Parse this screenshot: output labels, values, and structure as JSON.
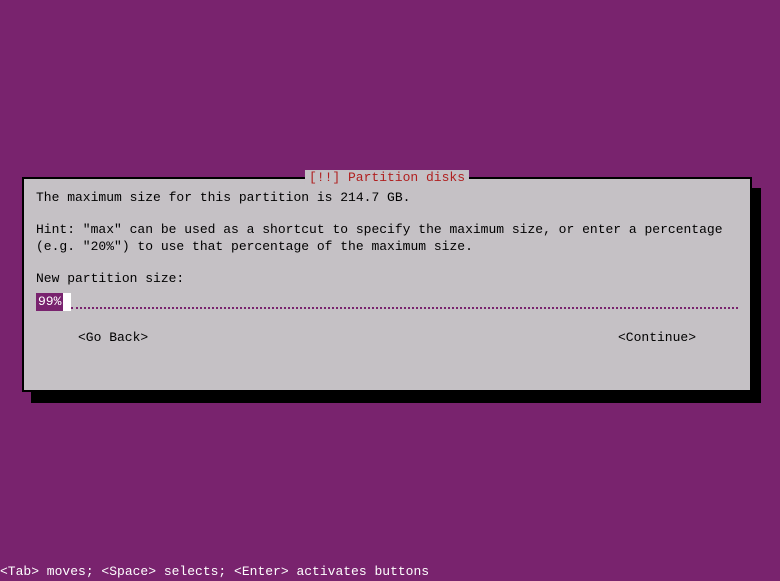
{
  "dialog": {
    "title_prefix": "[!!] ",
    "title_text": "Partition disks",
    "max_size_line": "The maximum size for this partition is 214.7 GB.",
    "hint_line": "Hint: \"max\" can be used as a shortcut to specify the maximum size, or enter a percentage (e.g. \"20%\") to use that percentage of the maximum size.",
    "prompt_label": "New partition size:",
    "input_value": "99%",
    "go_back_label": "<Go Back>",
    "continue_label": "<Continue>"
  },
  "footer": {
    "text": "<Tab> moves; <Space> selects; <Enter> activates buttons"
  }
}
